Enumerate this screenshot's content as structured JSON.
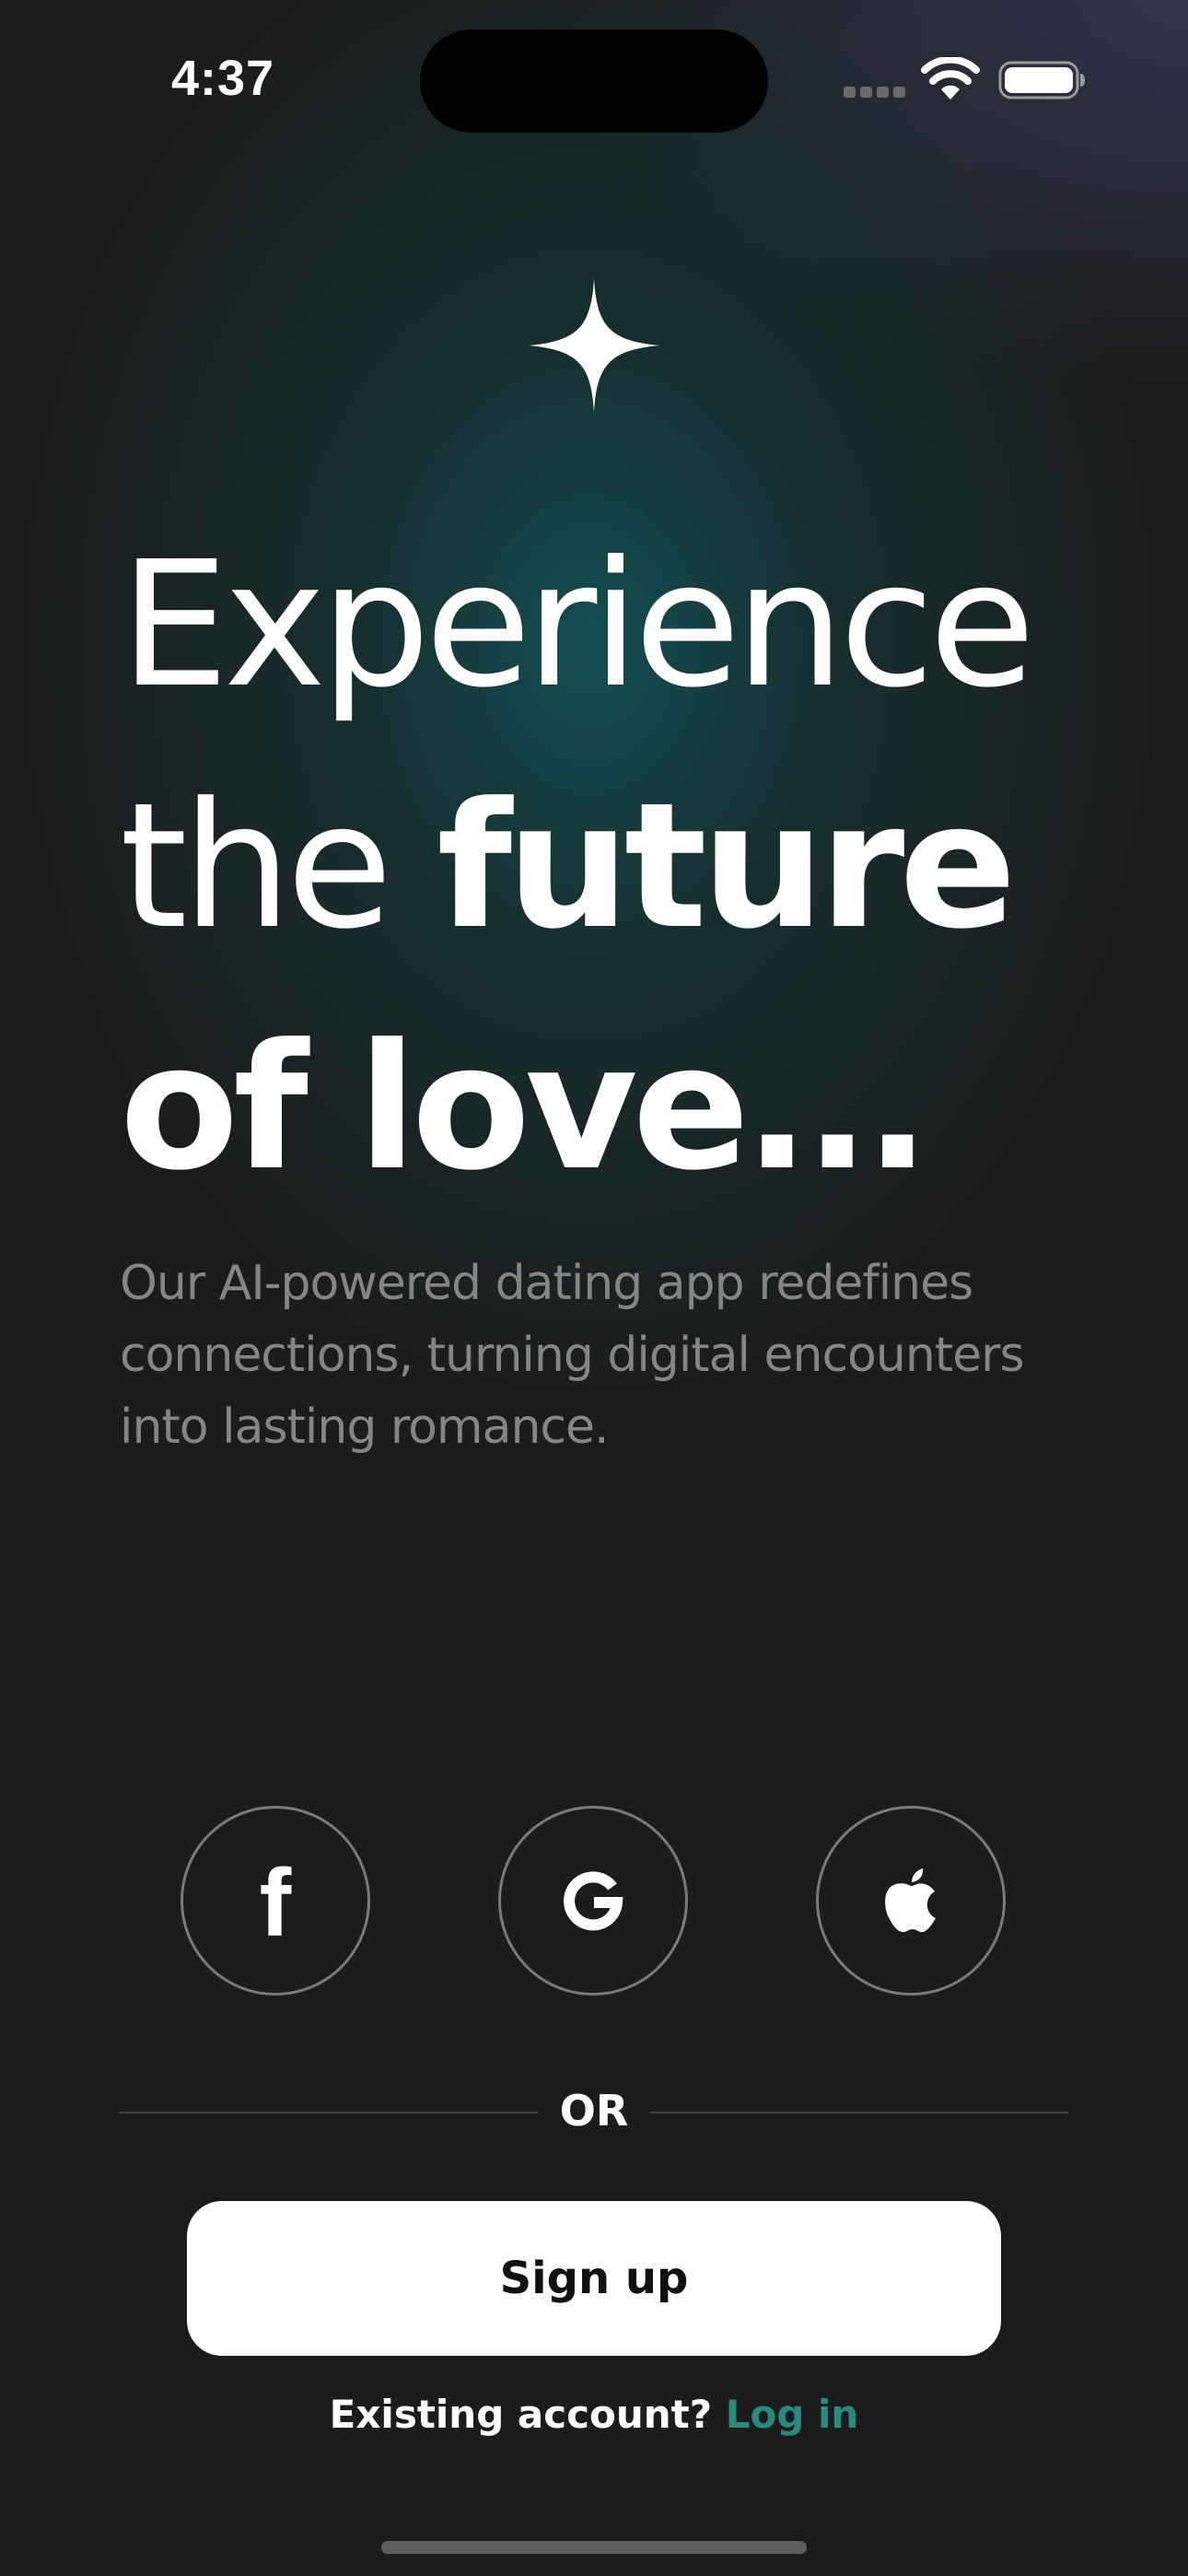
{
  "status_bar": {
    "time": "4:37"
  },
  "logo": {
    "icon": "sparkle-icon"
  },
  "headline": {
    "line1": "Experience",
    "line2_light": "the ",
    "line2_bold": "future",
    "line3": "of love..."
  },
  "subtitle": "Our AI-powered dating app redefines connections, turning digital encounters into lasting romance.",
  "social": {
    "facebook_icon": "facebook-icon",
    "google_icon": "google-icon",
    "apple_icon": "apple-icon"
  },
  "divider": {
    "label": "OR"
  },
  "signup": {
    "label": "Sign up"
  },
  "footer": {
    "prompt": "Existing account? ",
    "login_label": "Log in"
  },
  "colors": {
    "background": "#1c1c1c",
    "accent": "#2a8a80",
    "subtitle": "#858585"
  }
}
